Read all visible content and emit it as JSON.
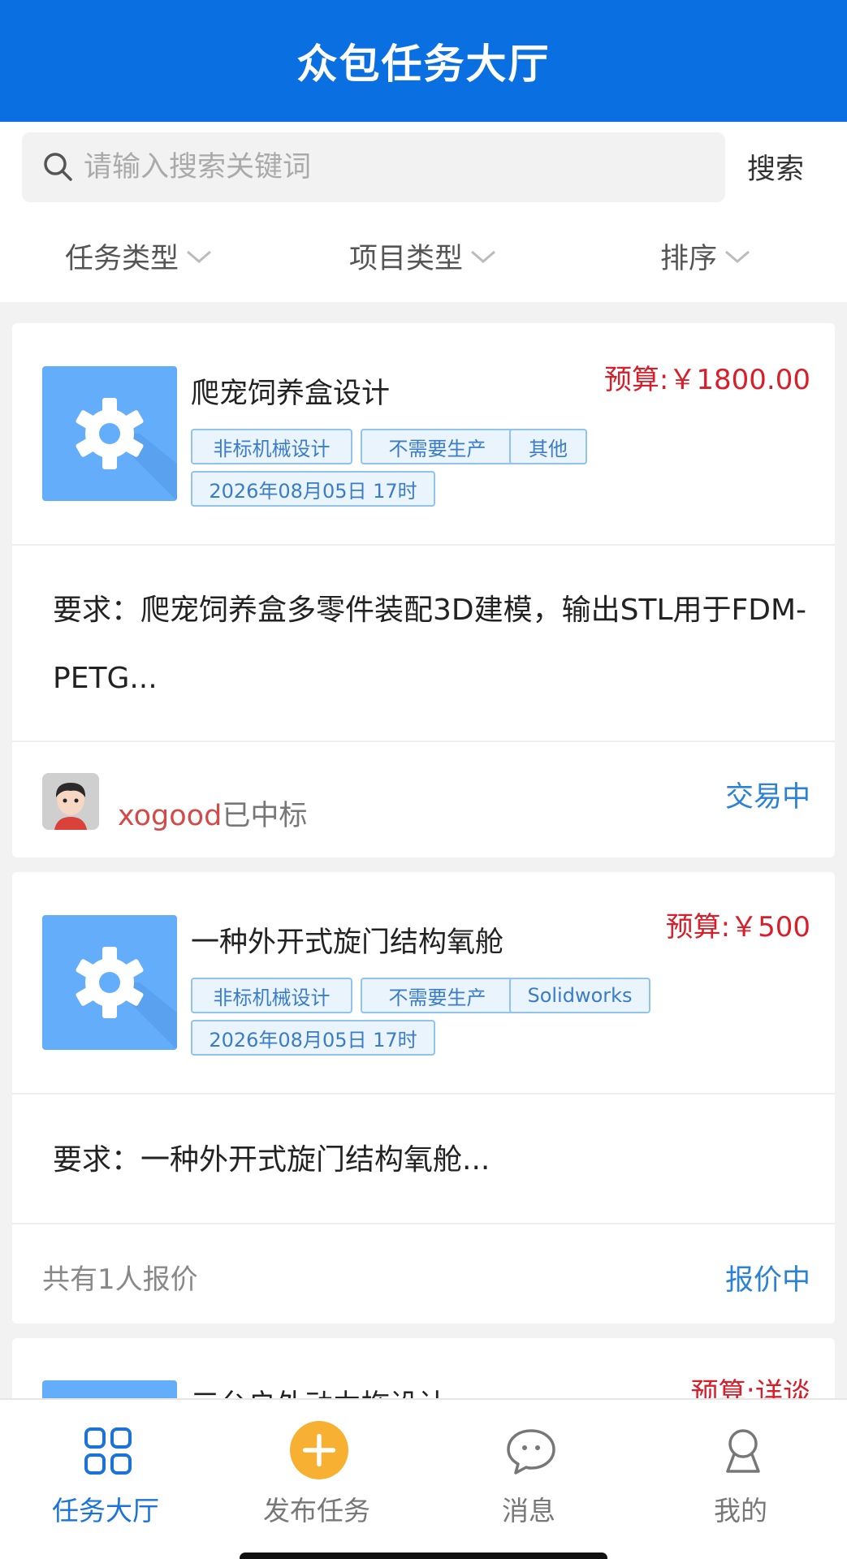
{
  "header": {
    "title": "众包任务大厅"
  },
  "search": {
    "placeholder": "请输入搜索关键词",
    "button_label": "搜索"
  },
  "filters": [
    {
      "label": "任务类型"
    },
    {
      "label": "项目类型"
    },
    {
      "label": "排序"
    }
  ],
  "tasks": [
    {
      "title": "爬宠饲养盒设计",
      "budget": "预算:￥1800.00",
      "tags": [
        "非标机械设计",
        "不需要生产",
        "其他"
      ],
      "deadline": "2026年08月05日 17时",
      "requirement": "要求：爬宠饲养盒多零件装配3D建模，输出STL用于FDM-PETG...",
      "winner_name": "xogood",
      "winner_suffix": "已中标",
      "status": "交易中"
    },
    {
      "title": "一种外开式旋门结构氧舱",
      "budget": "预算:￥500",
      "tags": [
        "非标机械设计",
        "不需要生产",
        "Solidworks"
      ],
      "deadline": "2026年08月05日 17时",
      "requirement": "要求：一种外开式旋门结构氧舱...",
      "quote_count": "共有1人报价",
      "status": "报价中"
    },
    {
      "title": "三台户外动力拖设计",
      "budget": "预算:详谈"
    }
  ],
  "tabbar": {
    "items": [
      {
        "label": "任务大厅",
        "icon": "grid-icon",
        "active": true
      },
      {
        "label": "发布任务",
        "icon": "plus-circle-icon"
      },
      {
        "label": "消息",
        "icon": "chat-bubble-icon"
      },
      {
        "label": "我的",
        "icon": "user-icon"
      }
    ]
  },
  "colors": {
    "header_bg": "#0a6fe0",
    "budget": "#d81e2a",
    "status": "#2b82d4",
    "tag_border": "#8fc4ee",
    "tab_active": "#1a73d9",
    "publish_button": "#f7b031"
  }
}
